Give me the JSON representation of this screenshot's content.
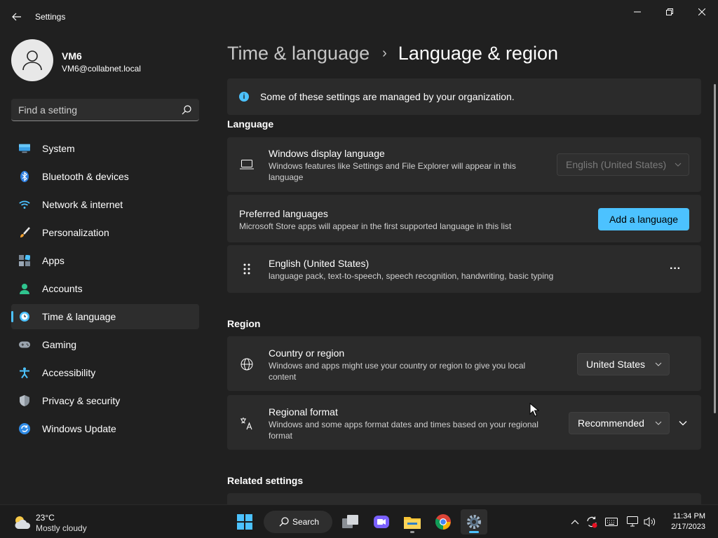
{
  "window": {
    "title": "Settings"
  },
  "user": {
    "name": "VM6",
    "email": "VM6@collabnet.local"
  },
  "search": {
    "placeholder": "Find a setting"
  },
  "sidebar": {
    "items": [
      {
        "label": "System",
        "icon": "system-icon",
        "active": false
      },
      {
        "label": "Bluetooth & devices",
        "icon": "bluetooth-icon",
        "active": false
      },
      {
        "label": "Network & internet",
        "icon": "wifi-icon",
        "active": false
      },
      {
        "label": "Personalization",
        "icon": "brush-icon",
        "active": false
      },
      {
        "label": "Apps",
        "icon": "apps-icon",
        "active": false
      },
      {
        "label": "Accounts",
        "icon": "accounts-icon",
        "active": false
      },
      {
        "label": "Time & language",
        "icon": "clock-globe-icon",
        "active": true
      },
      {
        "label": "Gaming",
        "icon": "controller-icon",
        "active": false
      },
      {
        "label": "Accessibility",
        "icon": "accessibility-icon",
        "active": false
      },
      {
        "label": "Privacy & security",
        "icon": "shield-icon",
        "active": false
      },
      {
        "label": "Windows Update",
        "icon": "update-icon",
        "active": false
      }
    ]
  },
  "breadcrumb": {
    "parent": "Time & language",
    "separator": "›",
    "current": "Language & region"
  },
  "info_bar": {
    "icon": "info-icon",
    "text": "Some of these settings are managed by your organization."
  },
  "language": {
    "section_title": "Language",
    "display_language": {
      "title": "Windows display language",
      "description": "Windows features like Settings and File Explorer will appear in this language",
      "value": "English (United States)",
      "disabled": true
    },
    "preferred": {
      "title": "Preferred languages",
      "description": "Microsoft Store apps will appear in the first supported language in this list",
      "button_label": "Add a language"
    },
    "installed": {
      "title": "English (United States)",
      "description": "language pack, text-to-speech, speech recognition, handwriting, basic typing",
      "more_label": "···"
    }
  },
  "region": {
    "section_title": "Region",
    "country": {
      "title": "Country or region",
      "description": "Windows and apps might use your country or region to give you local content",
      "value": "United States"
    },
    "format": {
      "title": "Regional format",
      "description": "Windows and some apps format dates and times based on your regional format",
      "value": "Recommended"
    }
  },
  "related": {
    "section_title": "Related settings"
  },
  "taskbar": {
    "weather_temp": "23°C",
    "weather_desc": "Mostly cloudy",
    "search_label": "Search",
    "time": "11:34 PM",
    "date": "2/17/2023"
  },
  "colors": {
    "accent": "#4cc2ff",
    "background": "#202020",
    "card": "#2b2b2b"
  }
}
